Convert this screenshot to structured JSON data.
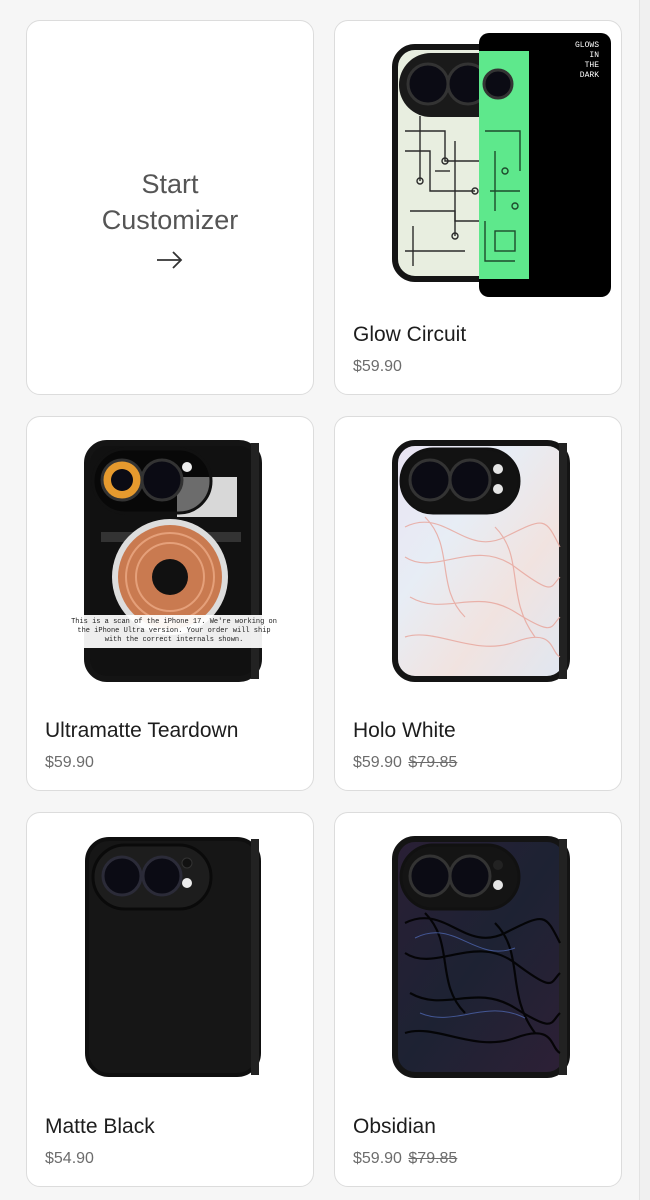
{
  "customizer": {
    "line1": "Start",
    "line2": "Customizer",
    "arrow_icon": "arrow-right-icon"
  },
  "products": [
    {
      "name": "Glow Circuit",
      "price": "$59.90",
      "old_price": "",
      "tag": "GLOWS\nIN\nTHE\nDARK",
      "image": "glow-circuit-case"
    },
    {
      "name": "Ultramatte Teardown",
      "price": "$59.90",
      "old_price": "",
      "overlay_note": "This is a scan of the iPhone 17. We're working on the iPhone Ultra version. Your order will ship with the correct internals shown.",
      "image": "teardown-case"
    },
    {
      "name": "Holo White",
      "price": "$59.90",
      "old_price": "$79.85",
      "image": "holo-white-case"
    },
    {
      "name": "Matte Black",
      "price": "$54.90",
      "old_price": "",
      "image": "matte-black-case"
    },
    {
      "name": "Obsidian",
      "price": "$59.90",
      "old_price": "$79.85",
      "image": "obsidian-case"
    }
  ],
  "colors": {
    "glow_green": "#5ee88c",
    "copper": "#c97a50",
    "card_border": "#dcdcdc"
  }
}
